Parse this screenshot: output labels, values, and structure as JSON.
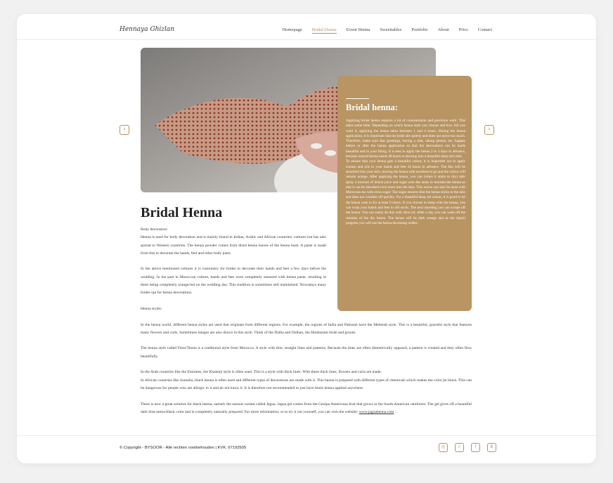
{
  "header": {
    "logo": "Hennaya Ghizlan",
    "nav": [
      "Homepage",
      "Bridal Henna",
      "Event Henna",
      "Sweettables",
      "Portfolio",
      "About",
      "Prics",
      "Contact"
    ],
    "active_index": 1
  },
  "carousel": {
    "prev_icon": "‹",
    "next_icon": "›"
  },
  "panel": {
    "title": "Bridal henna:",
    "p1": "Applying bridal henna requires a lot of concentration and precision work. This takes some time. Depending on which henna style you choose and how full you want it, applying the henna takes between 1 and 4 hours. During the henna application, it is important that the bride sits quietly and does not move too much. Therefore, make sure that greetings, having a chat, taking photos, etc. happen before or after the henna application so that the decorations can be made beautiful and to your liking. It is best to apply the henna 2 to 3 days in advance, because natural henna needs 48 hours to develop into a beautiful deep red color.",
    "p2": "To ensure that your henna gets a beautiful colour, it is important not to apply creams and oils to your hands and feet 24 hours in advance. The fats will be absorbed into your skin, leaving the henna with nowhere to go and the colour will remain orange. After applying the henna, you can (when it starts to dry) dab/ spray a mixture of lemon juice and sugar onto the areas to moisten the henna so that it can be absorbed even more into the skin. This action can also be done with Moroccan tea with extra sugar. The sugar ensures that the henna sticks to the skin and does not crumble off quickly. For a beautiful deep red colour, it is good to let the henna soak in for at least 6 hours. If you choose to sleep with the henna, you can wrap your hands and feet in old socks. The next morning you can scrape off the henna. You can easily do this with olive oil. After a day you can wash off the remains of the dry henna. The henna will be dark orange and as the day(s) progress you will see the henna becoming redder."
  },
  "main": {
    "title": "Bridal Henna",
    "body_decoration_heading": "Body decoration:",
    "p1": "Henna is used for body decoration and is mainly found in Indian, Arabic and African countries/ cultures but has also spread to Western countries. The henna powder comes from dried henna leaves of the henna bush. A paste is made from this to decorate the hands, feet and other body parts.",
    "p2": "In the above mentioned cultures it is customary for brides to decorate their hands and feet a few days before the wedding. In the past in Moroccan culture, hands and feet were completely smeared with henna paste, resulting in them being completely orange/red on the wedding day. This tradition is sometimes still maintained. Nowadays many brides opt for henna decorations.",
    "styles_heading": "Henna styles:",
    "p3": "In the henna world, different henna styles are used that originate from different regions. For example, the regions of India and Pakistan have the Mehendi style. This is a beautiful, graceful style that features many flowers and curls. Sometimes images are also drawn in this style. Think of the Dulha and Dulhan, the Hindustani bride and groom.",
    "p4": "The henna style called Fessi/Tessia is a traditional style from Morocco. A style with thin, straight lines and patterns. Because the lines are often diametrically opposed, a pattern is created and they often flow beautifully.",
    "p5a": "In the Arab countries like the Emirates, the Khaleeji style is often used. This is a style with thick lines. With these thick lines, flowers and curls are made.",
    "p5b": "In African countries like Somalia, black henna is often used and different types of decorations are made with it. This henna is prepared with different types of chemicals which makes the color jet black. This can be dangerous for people who are allergic to it and do not know it. It is therefore not recommended to just have black henna applied anywhere.",
    "p6": "There is now a great solution for black henna, namely the natural variant called Jagua. Jagua gel comes from the Genipa Americana fruit that grows in the South American rainforest. The gel gives off a beautiful dark blue tattoo/black color and is completely naturally prepared. For more information, or to try it out yourself, you can visit the website:",
    "link": "www.jaguahenna.com",
    "after_link": " ."
  },
  "footer": {
    "copyright": "© Copyright - BYSOOR - Alle rechten voorbehouden | KVK: 67192505",
    "socials": [
      {
        "name": "instagram-icon",
        "glyph": "◎"
      },
      {
        "name": "twitter-icon",
        "glyph": "✓"
      },
      {
        "name": "facebook-icon",
        "glyph": "f"
      },
      {
        "name": "behance-icon",
        "glyph": "B"
      }
    ]
  },
  "colors": {
    "accent": "#b8925c",
    "panel": "#b89563"
  }
}
